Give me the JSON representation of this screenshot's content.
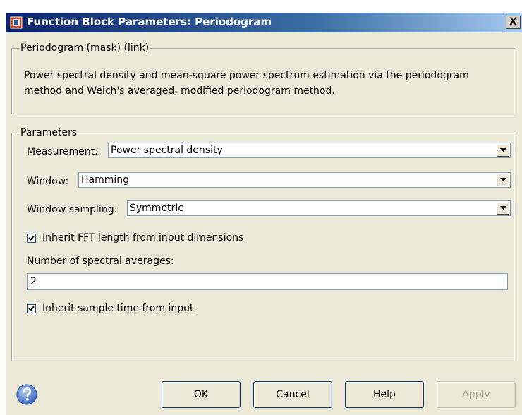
{
  "window": {
    "title": "Function Block Parameters: Periodogram",
    "close_glyph": "X"
  },
  "mask_group": {
    "legend": "Periodogram (mask) (link)",
    "description_line1": "Power spectral density and mean-square power spectrum estimation via the periodogram",
    "description_line2": "method and Welch's averaged, modified periodogram method."
  },
  "params_group": {
    "legend": "Parameters",
    "measurement": {
      "label": "Measurement:",
      "value": "Power spectral density"
    },
    "window": {
      "label": "Window:",
      "value": "Hamming"
    },
    "window_sampling": {
      "label": "Window sampling:",
      "value": "Symmetric"
    },
    "inherit_fft": {
      "label": "Inherit FFT length from input dimensions",
      "checked": true
    },
    "spectral_averages": {
      "label": "Number of spectral averages:",
      "value": "2"
    },
    "inherit_sample_time": {
      "label": "Inherit sample time from input",
      "checked": true
    }
  },
  "buttons": {
    "ok": "OK",
    "cancel": "Cancel",
    "help": "Help",
    "apply": "Apply"
  },
  "icons": {
    "title_icon": "simulink-block-icon",
    "help_icon": "question-mark-help-icon",
    "dropdown_icon": "chevron-down-icon",
    "check_icon": "checkmark-icon"
  },
  "colors": {
    "title_bar_start": "#0a246a",
    "title_bar_end": "#a6caf0",
    "dialog_background": "#ece9d8"
  }
}
